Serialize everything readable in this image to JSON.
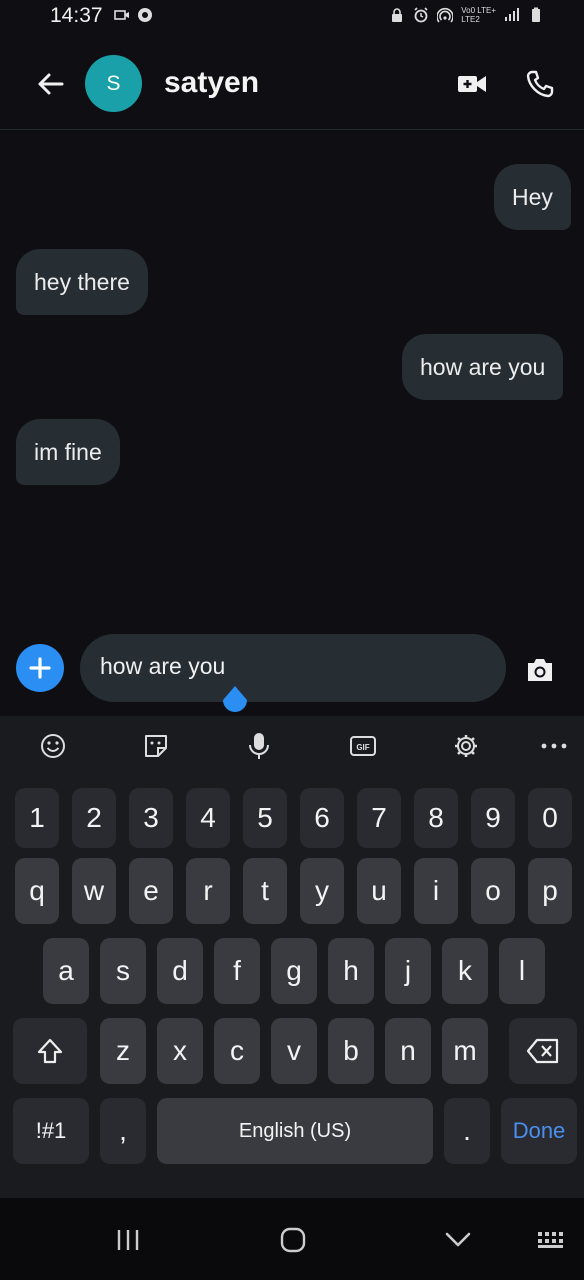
{
  "status_bar": {
    "time": "14:37",
    "network_top": "Vo0 LTE+",
    "network_bottom": "LTE2"
  },
  "header": {
    "avatar_letter": "S",
    "contact_name": "satyen",
    "avatar_color": "#1aa0a8"
  },
  "messages": [
    {
      "direction": "outgoing",
      "text": "Hey"
    },
    {
      "direction": "incoming",
      "text": "hey there"
    },
    {
      "direction": "outgoing",
      "text": "how are you"
    },
    {
      "direction": "incoming",
      "text": "im fine"
    }
  ],
  "composer": {
    "input_value": "how are you",
    "accent_color": "#2a8ef3"
  },
  "keyboard": {
    "toolbar": [
      "emoji-icon",
      "sticker-icon",
      "mic-icon",
      "gif-icon",
      "settings-icon",
      "more-icon"
    ],
    "gif_label": "GIF",
    "number_row": [
      "1",
      "2",
      "3",
      "4",
      "5",
      "6",
      "7",
      "8",
      "9",
      "0"
    ],
    "row1": [
      "q",
      "w",
      "e",
      "r",
      "t",
      "y",
      "u",
      "i",
      "o",
      "p"
    ],
    "row2": [
      "a",
      "s",
      "d",
      "f",
      "g",
      "h",
      "j",
      "k",
      "l"
    ],
    "row3": [
      "z",
      "x",
      "c",
      "v",
      "b",
      "n",
      "m"
    ],
    "symbols_label": "!#1",
    "comma_label": ",",
    "space_label": "English (US)",
    "period_label": ".",
    "done_label": "Done"
  }
}
